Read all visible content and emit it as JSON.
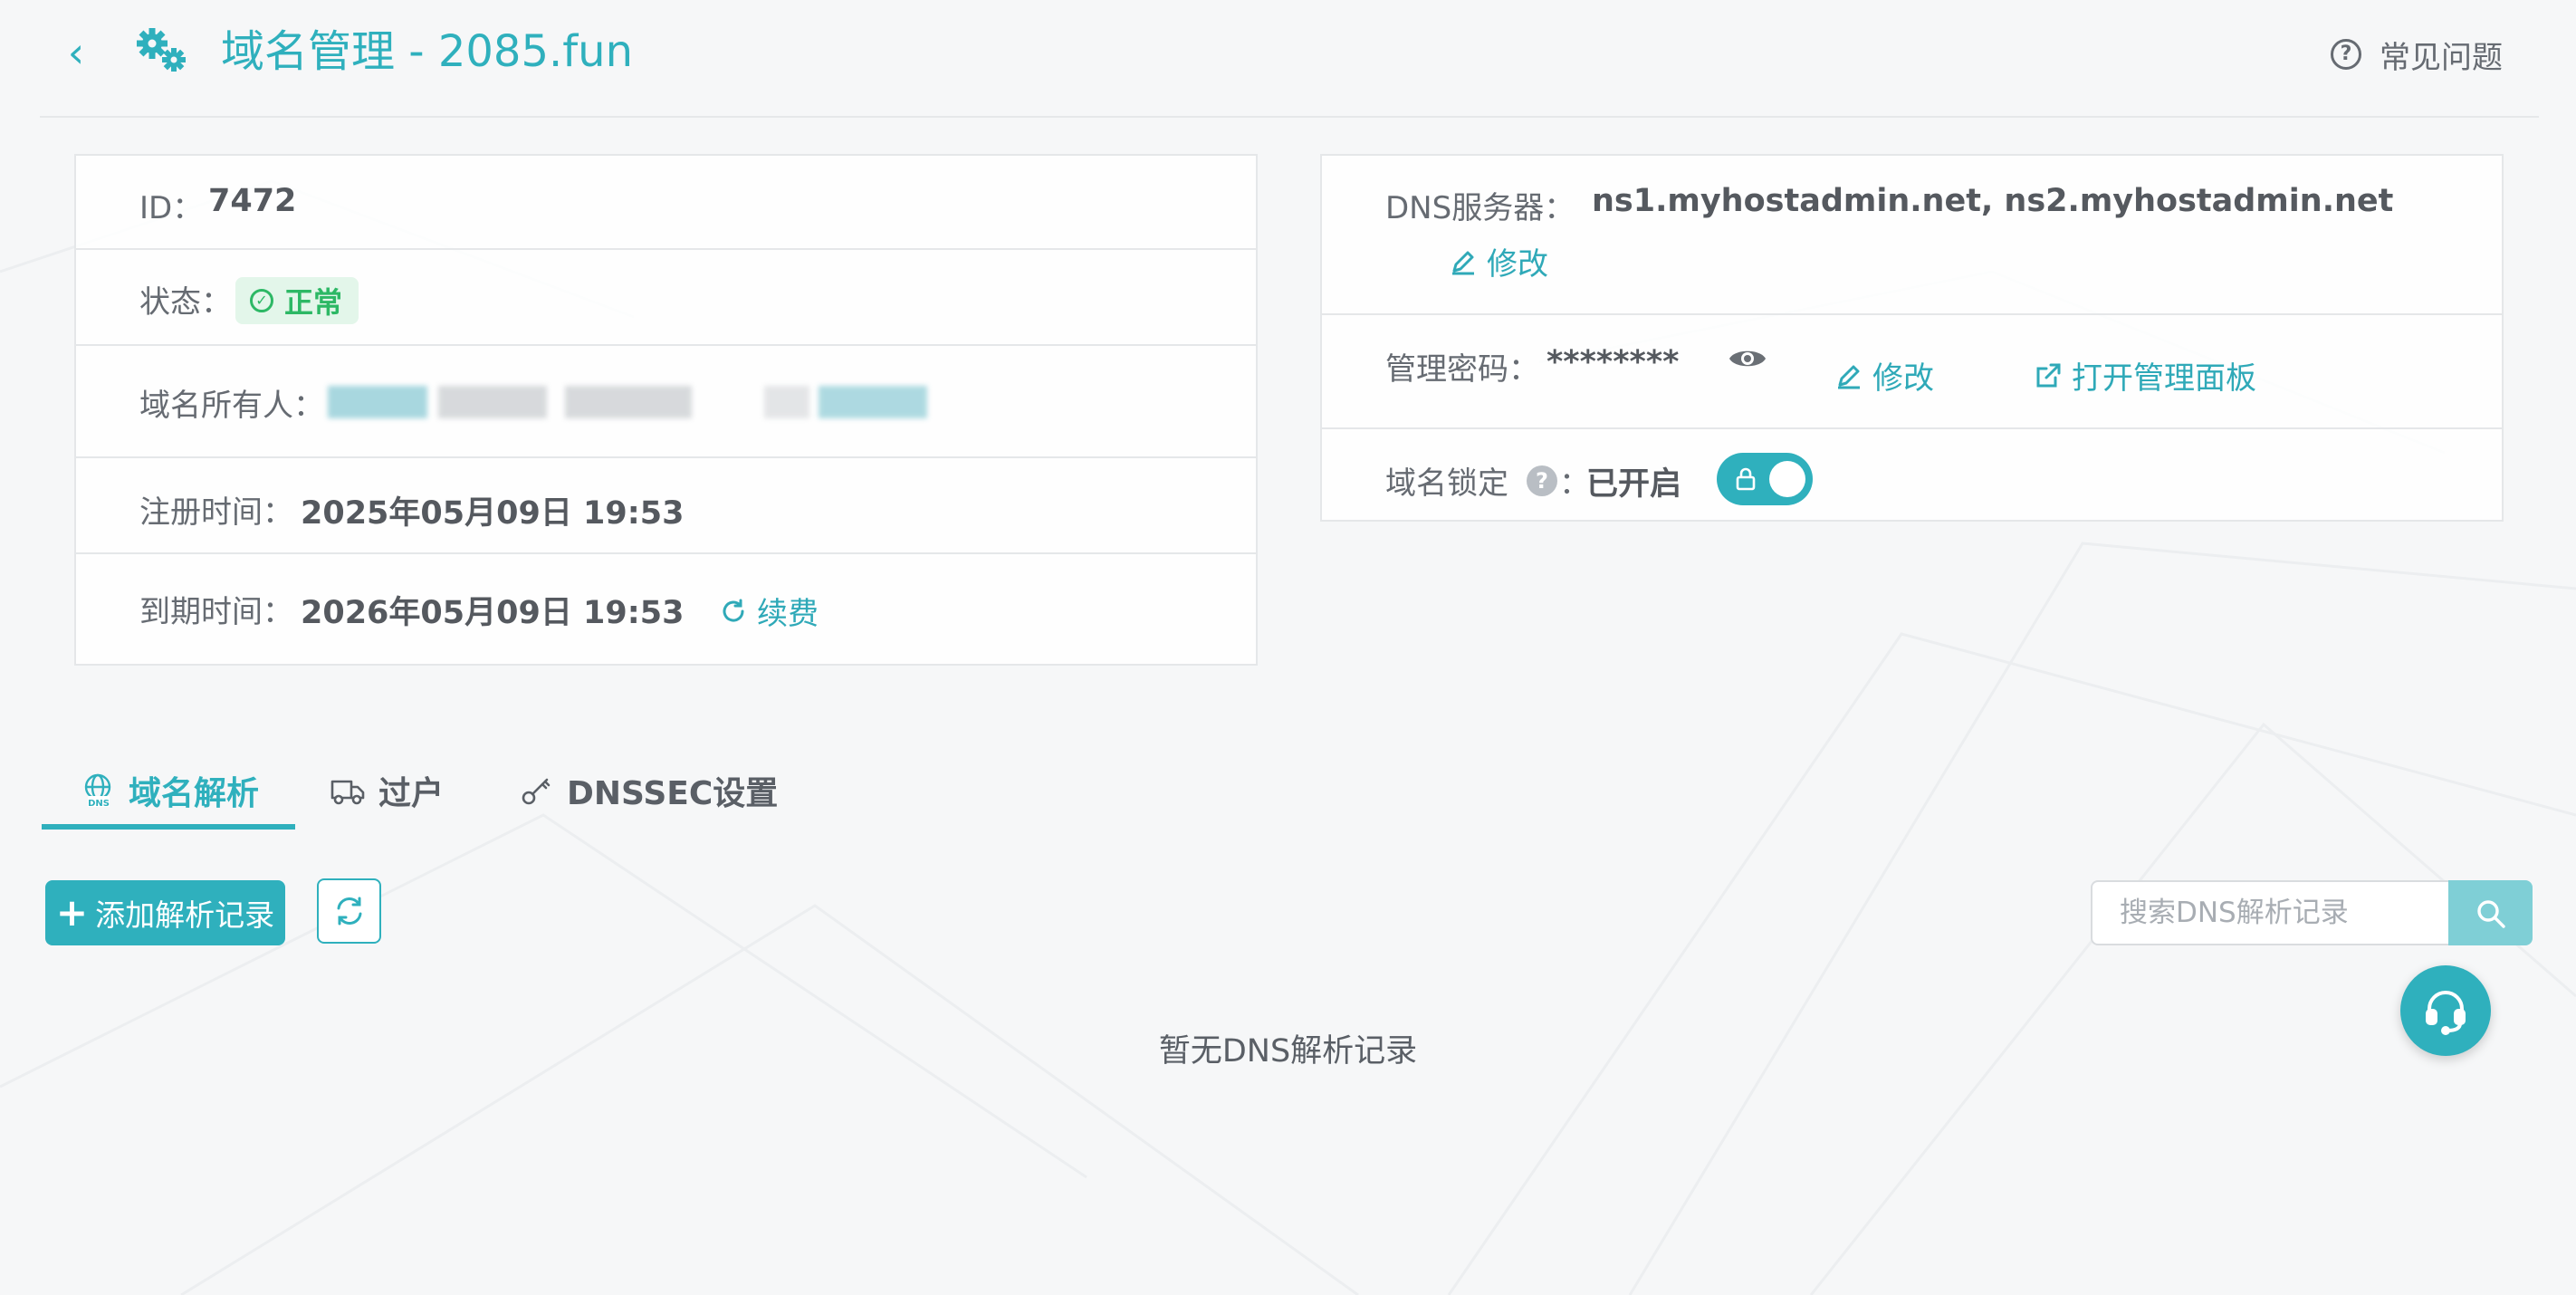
{
  "header": {
    "title": "域名管理 - 2085.fun",
    "faq_label": "常见问题"
  },
  "info": {
    "id_label": "ID：",
    "id_value": "7472",
    "status_label": "状态：",
    "status_value": "正常",
    "owner_label": "域名所有人：",
    "reg_label": "注册时间：",
    "reg_value": "2025年05月09日 19:53",
    "exp_label": "到期时间：",
    "exp_value": "2026年05月09日 19:53",
    "renew_label": "续费"
  },
  "dns": {
    "server_label": "DNS服务器：",
    "server_value": "ns1.myhostadmin.net, ns2.myhostadmin.net",
    "modify_label": "修改",
    "password_label": "管理密码：",
    "password_value": "********",
    "password_modify_label": "修改",
    "open_panel_label": "打开管理面板",
    "lock_label": "域名锁定",
    "lock_colon": "：",
    "lock_value": "已开启",
    "help_symbol": "?"
  },
  "tabs": [
    {
      "label": "域名解析",
      "active": true
    },
    {
      "label": "过户",
      "active": false
    },
    {
      "label": "DNSSEC设置",
      "active": false
    }
  ],
  "toolbar": {
    "add_label": "添加解析记录",
    "search_placeholder": "搜索DNS解析记录"
  },
  "empty_text": "暂无DNS解析记录",
  "colors": {
    "accent": "#2fb0bd",
    "success": "#2db865",
    "success_bg": "#e3f6ea",
    "search_button": "#7fcfd6"
  },
  "icons": {
    "back": "chevron-left-icon",
    "title": "gears-icon",
    "faq": "question-circle-icon",
    "status": "check-circle-icon",
    "edit": "pencil-icon",
    "password_view": "eye-icon",
    "open_panel": "external-link-icon",
    "lock": "lock-icon",
    "renew": "rotate-icon",
    "tab_dns": "globe-dns-icon",
    "tab_transfer": "truck-icon",
    "tab_dnssec": "key-icon",
    "refresh": "refresh-icon",
    "search": "search-icon",
    "support": "headset-icon"
  }
}
